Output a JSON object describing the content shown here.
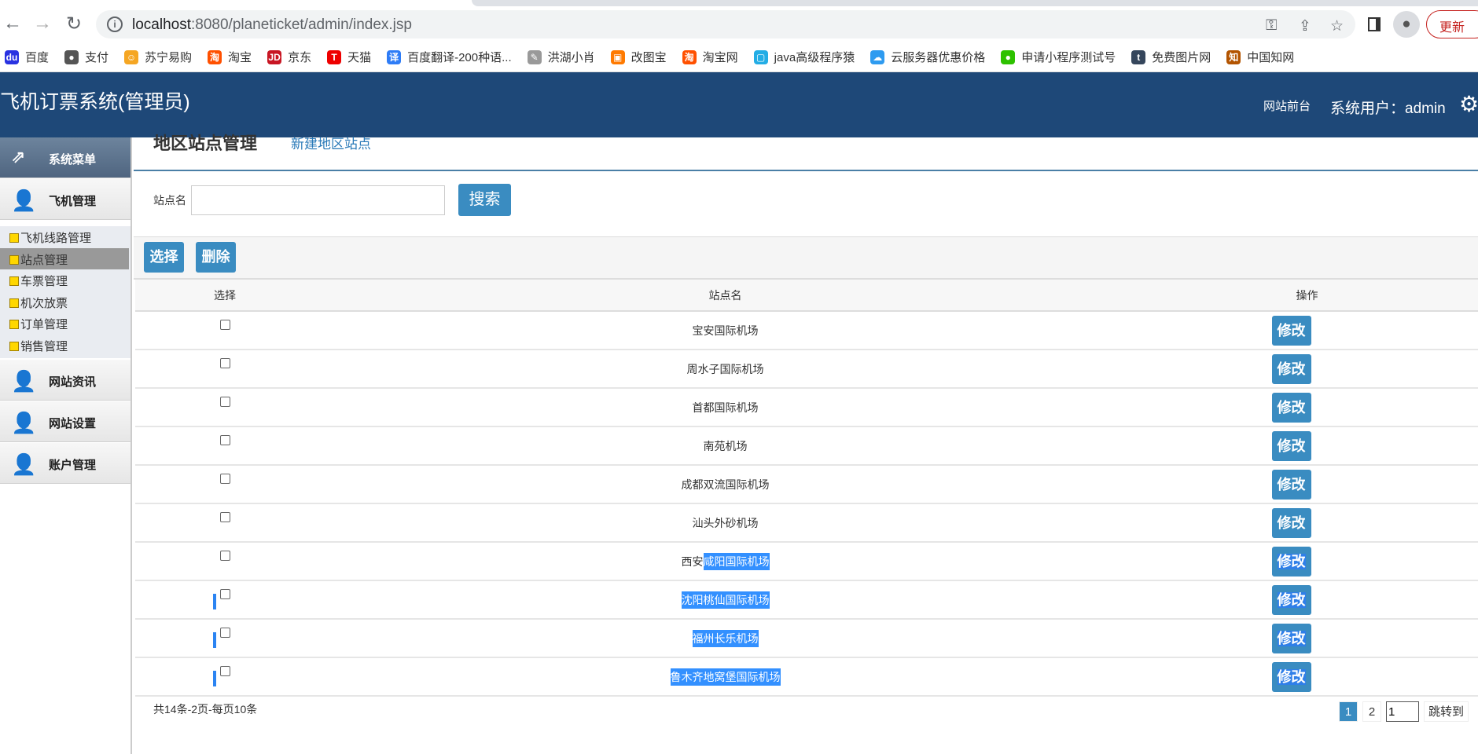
{
  "browser": {
    "url_host": "localhost",
    "url_rest": ":8080/planeticket/admin/index.jsp",
    "update_label": "更新",
    "bookmarks": [
      {
        "label": "百度",
        "color": "#2932e1",
        "glyph": "du"
      },
      {
        "label": "支付",
        "color": "#555",
        "glyph": "●"
      },
      {
        "label": "苏宁易购",
        "color": "#f5a623",
        "glyph": "☺"
      },
      {
        "label": "淘宝",
        "color": "#ff5000",
        "glyph": "淘"
      },
      {
        "label": "京东",
        "color": "#c81623",
        "glyph": "JD"
      },
      {
        "label": "天猫",
        "color": "#e00",
        "glyph": "T"
      },
      {
        "label": "百度翻译-200种语...",
        "color": "#2e7cf6",
        "glyph": "译"
      },
      {
        "label": "洪湖小肖",
        "color": "#999",
        "glyph": "✎"
      },
      {
        "label": "改图宝",
        "color": "#ff7a00",
        "glyph": "▣"
      },
      {
        "label": "淘宝网",
        "color": "#ff5000",
        "glyph": "淘"
      },
      {
        "label": "java高级程序猿",
        "color": "#23ade5",
        "glyph": "▢"
      },
      {
        "label": "云服务器优惠价格",
        "color": "#2e9bf0",
        "glyph": "☁"
      },
      {
        "label": "申请小程序测试号",
        "color": "#2dc100",
        "glyph": "●"
      },
      {
        "label": "免费图片网",
        "color": "#35465c",
        "glyph": "t"
      },
      {
        "label": "中国知网",
        "color": "#b35400",
        "glyph": "知"
      }
    ]
  },
  "header": {
    "title": "飞机订票系统(管理员)",
    "front_link": "网站前台",
    "user_label": "系统用户：admin"
  },
  "sidebar": {
    "menu_title": "系统菜单",
    "groups": [
      "飞机管理",
      "网站资讯",
      "网站设置",
      "账户管理"
    ],
    "items": [
      "飞机线路管理",
      "站点管理",
      "车票管理",
      "机次放票",
      "订单管理",
      "销售管理"
    ],
    "active_item": "站点管理"
  },
  "page": {
    "title": "地区站点管理",
    "new_link": "新建地区站点",
    "search_label": "站点名",
    "search_value": "",
    "search_button": "搜索",
    "select_button": "选择",
    "delete_button": "删除"
  },
  "table": {
    "headers": [
      "选择",
      "站点名",
      "操作"
    ],
    "edit_label": "修改",
    "rows": [
      {
        "pre": "宝安国际机场",
        "sel": ""
      },
      {
        "pre": "周水子国际机场",
        "sel": ""
      },
      {
        "pre": "首都国际机场",
        "sel": ""
      },
      {
        "pre": "南苑机场",
        "sel": ""
      },
      {
        "pre": "成都双流国际机场",
        "sel": ""
      },
      {
        "pre": "汕头外砂机场",
        "sel": ""
      },
      {
        "pre": "西安",
        "sel": "咸阳国际机场"
      },
      {
        "pre": "",
        "sel": "沈阳桃仙国际机场"
      },
      {
        "pre": "",
        "sel": "福州长乐机场"
      },
      {
        "pre": "",
        "sel": "鲁木齐地窝堡国际机场"
      }
    ]
  },
  "pagination": {
    "summary": "共14条-2页-每页10条",
    "pages": [
      "1",
      "2"
    ],
    "current": "1",
    "jump_value": "1",
    "jump_label": "跳转到"
  }
}
